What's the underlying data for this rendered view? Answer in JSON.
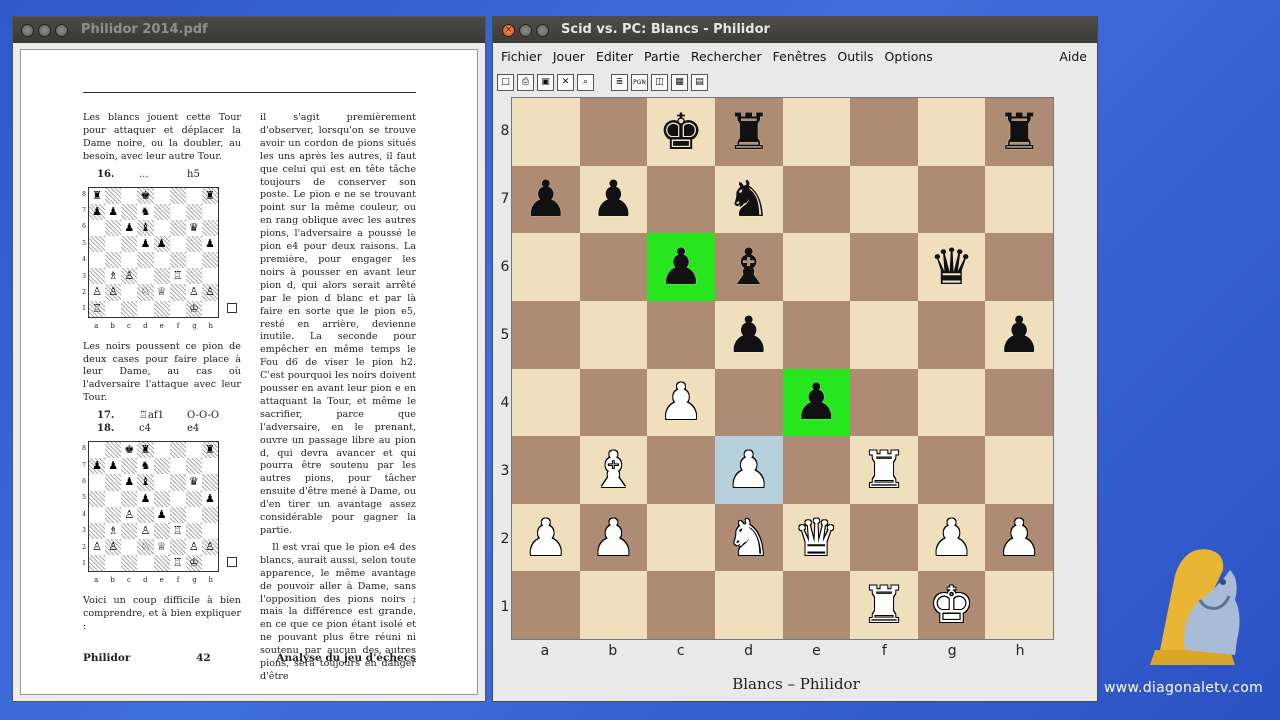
{
  "pdf_window": {
    "title": "Philidor 2014.pdf",
    "para1": "Les blancs jouent cette Tour pour attaquer et déplacer la Dame noire, ou la doubler, au besoin, avec leur autre Tour.",
    "move16": {
      "num": "16.",
      "white": "...",
      "black": "h5"
    },
    "para2": "Les noirs poussent ce pion de deux cases pour faire place à leur Dame, au cas où l'adversaire l'attaque avec leur Tour.",
    "move17": {
      "num": "17.",
      "white": "♖af1",
      "black": "O-O-O"
    },
    "move18": {
      "num": "18.",
      "white": "c4",
      "black": "e4"
    },
    "para3": "Voici un coup difficile à bien comprendre, et à bien expliquer :",
    "right_col": "il s'agit premièrement d'observer, lorsqu'on se trouve avoir un cordon de pions situés les uns après les autres, il faut que celui qui est en tête tâche toujours de conserver son poste. Le pion e ne se trouvant point sur la même couleur, ou en rang oblique avec les autres pions, l'adversaire a poussé le pion e4 pour deux raisons. La première, pour engager les noirs à pousser en avant leur pion d, qui alors serait arrêté par le pion d blanc et par là faire en sorte que le pion e5, resté en arrière, devienne inutile. La seconde pour empêcher en même temps le Fou d6 de viser le pion h2. C'est pourquoi les noirs doivent pousser en avant leur pion e en attaquant la Tour, et même le sacrifier, parce que l'adversaire, en le prenant, ouvre un passage libre au pion d, qui devra avancer et qui pourra être soutenu par les autres pions, pour tâcher ensuite d'être mené à Dame, ou d'en tirer un avantage assez considérable pour gagner la partie.",
    "right_col2": "Il est vrai que le pion e4 des blancs, aurait aussi, selon toute apparence, le même avantage de pouvoir aller à Dame, sans l'opposition des pions noirs ; mais la différence est grande, en ce que ce pion étant isolé et ne pouvant plus être réuni ni soutenu par aucun des autres pions, sera toujours en danger d'être",
    "footer_left": "Philidor",
    "footer_page": "42",
    "footer_right": "Analyse du jeu d'échecs",
    "mini_ranks": [
      "8",
      "7",
      "6",
      "5",
      "4",
      "3",
      "2",
      "1"
    ],
    "mini_files": [
      "a",
      "b",
      "c",
      "d",
      "e",
      "f",
      "g",
      "h"
    ],
    "diagram1": [
      "♜",
      "",
      "",
      "♚",
      "",
      "",
      "",
      "♜",
      "♟",
      "♟",
      "",
      "♞",
      "",
      "",
      "",
      "",
      "",
      "",
      "♟",
      "♝",
      "",
      "",
      "♛",
      "",
      "",
      "",
      "",
      "♟",
      "♟",
      "",
      "",
      "♟",
      "",
      "",
      "",
      "",
      "",
      "",
      "",
      "",
      "",
      "♗",
      "♙",
      "",
      "",
      "♖",
      "",
      "",
      "♙",
      "♙",
      "",
      "♘",
      "♕",
      "",
      "♙",
      "♙",
      "♖",
      "",
      "",
      "",
      "",
      "",
      "♔",
      ""
    ],
    "diagram2": [
      "",
      "",
      "♚",
      "♜",
      "",
      "",
      "",
      "♜",
      "♟",
      "♟",
      "",
      "♞",
      "",
      "",
      "",
      "",
      "",
      "",
      "♟",
      "♝",
      "",
      "",
      "♛",
      "",
      "",
      "",
      "",
      "♟",
      "",
      "",
      "",
      "♟",
      "",
      "",
      "♙",
      "",
      "♟",
      "",
      "",
      "",
      "",
      "♗",
      "",
      "♙",
      "",
      "♖",
      "",
      "",
      "♙",
      "♙",
      "",
      "♘",
      "♕",
      "",
      "♙",
      "♙",
      "",
      "",
      "",
      "",
      "",
      "♖",
      "♔",
      ""
    ]
  },
  "scid_window": {
    "title": "Scid vs. PC: Blancs - Philidor",
    "menu": [
      "Fichier",
      "Jouer",
      "Editer",
      "Partie",
      "Rechercher",
      "Fenêtres",
      "Outils",
      "Options"
    ],
    "help": "Aide",
    "toolbar": [
      {
        "icon": "new-game-icon",
        "glyph": "□"
      },
      {
        "icon": "print-icon",
        "glyph": "⎙"
      },
      {
        "icon": "save-icon",
        "glyph": "▣"
      },
      {
        "icon": "delete-icon",
        "glyph": "✕"
      },
      {
        "icon": "find-icon",
        "glyph": "⌕"
      },
      {
        "icon": "gamelist-icon",
        "glyph": "≣"
      },
      {
        "icon": "pgn-icon",
        "glyph": "PGN"
      },
      {
        "icon": "tree-icon",
        "glyph": "◫"
      },
      {
        "icon": "crosstable-icon",
        "glyph": "▦"
      },
      {
        "icon": "engine-icon",
        "glyph": "▤"
      }
    ],
    "ranks": [
      "8",
      "7",
      "6",
      "5",
      "4",
      "3",
      "2",
      "1"
    ],
    "files": [
      "a",
      "b",
      "c",
      "d",
      "e",
      "f",
      "g",
      "h"
    ],
    "board": [
      [
        "",
        "",
        "bk",
        "br",
        "",
        "",
        "",
        "br"
      ],
      [
        "bp",
        "bp",
        "",
        "bn",
        "",
        "",
        "",
        ""
      ],
      [
        "",
        "",
        "bp",
        "bb",
        "",
        "",
        "bq",
        ""
      ],
      [
        "",
        "",
        "",
        "bp",
        "",
        "",
        "",
        "bp"
      ],
      [
        "",
        "",
        "wp",
        "",
        "bp",
        "",
        "",
        ""
      ],
      [
        "",
        "wb",
        "",
        "wp",
        "",
        "wr",
        "",
        ""
      ],
      [
        "wp",
        "wp",
        "",
        "wn",
        "wq",
        "",
        "wp",
        "wp"
      ],
      [
        "",
        "",
        "",
        "",
        "",
        "wr",
        "wk",
        ""
      ]
    ],
    "highlights": {
      "c6": "green",
      "e4": "green",
      "d3": "blue"
    },
    "players": "Blancs  –  Philidor"
  },
  "watermark": "www.diagonaletv.com"
}
